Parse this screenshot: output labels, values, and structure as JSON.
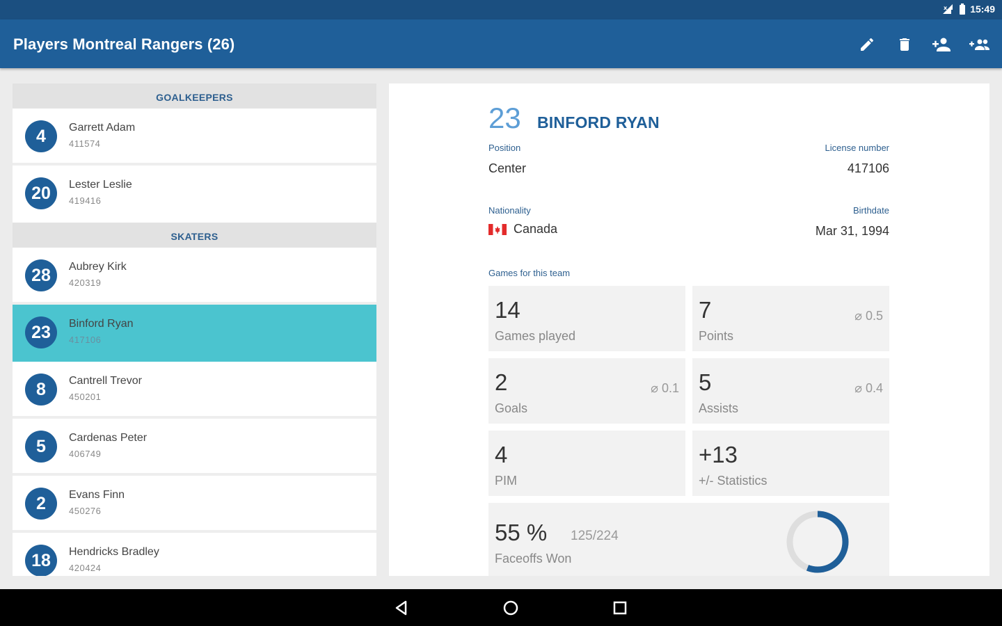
{
  "status_bar": {
    "time": "15:49"
  },
  "app_bar": {
    "title": "Players Montreal Rangers (26)",
    "actions": [
      "edit-icon",
      "delete-icon",
      "add-player-icon",
      "group-icon"
    ]
  },
  "list": {
    "sections": [
      {
        "header": "GOALKEEPERS",
        "players": [
          {
            "number": "4",
            "name": "Garrett Adam",
            "license": "411574"
          },
          {
            "number": "20",
            "name": "Lester Leslie",
            "license": "419416"
          }
        ]
      },
      {
        "header": "SKATERS",
        "players": [
          {
            "number": "28",
            "name": "Aubrey Kirk",
            "license": "420319"
          },
          {
            "number": "23",
            "name": "Binford Ryan",
            "license": "417106",
            "selected": true
          },
          {
            "number": "8",
            "name": "Cantrell Trevor",
            "license": "450201"
          },
          {
            "number": "5",
            "name": "Cardenas Peter",
            "license": "406749"
          },
          {
            "number": "2",
            "name": "Evans Finn",
            "license": "450276"
          },
          {
            "number": "18",
            "name": "Hendricks Bradley",
            "license": "420424"
          }
        ]
      }
    ]
  },
  "detail": {
    "number": "23",
    "name": "BINFORD RYAN",
    "position_label": "Position",
    "position": "Center",
    "license_label": "License number",
    "license": "417106",
    "nationality_label": "Nationality",
    "nationality": "Canada",
    "birthdate_label": "Birthdate",
    "birthdate": "Mar 31, 1994",
    "games_label": "Games for this team",
    "stats": {
      "games": {
        "value": "14",
        "label": "Games played"
      },
      "points": {
        "value": "7",
        "label": "Points",
        "avg": "⌀ 0.5"
      },
      "goals": {
        "value": "2",
        "label": "Goals",
        "avg": "⌀ 0.1"
      },
      "assists": {
        "value": "5",
        "label": "Assists",
        "avg": "⌀ 0.4"
      },
      "pim": {
        "value": "4",
        "label": "PIM"
      },
      "plusminus": {
        "value": "+13",
        "label": "+/- Statistics"
      },
      "faceoffs": {
        "value": "55 %",
        "extra": "125/224",
        "label": "Faceoffs Won",
        "fraction": 0.558
      }
    }
  },
  "colors": {
    "primary": "#1f5f99",
    "status": "#1b4f80",
    "selected": "#4bc4cf",
    "accent": "#5d9ed6"
  }
}
